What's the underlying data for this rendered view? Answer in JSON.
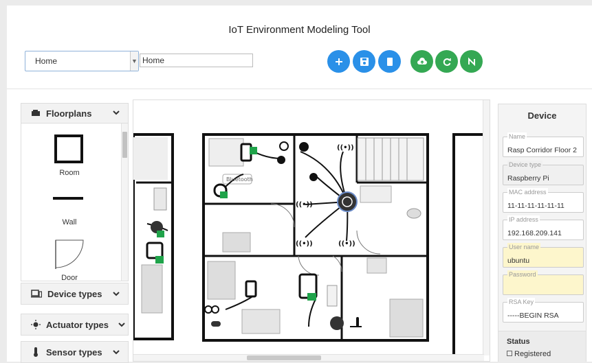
{
  "app": {
    "title": "IoT Environment Modeling Tool"
  },
  "toolbar": {
    "environment_select": "Home",
    "environment_name": "Home",
    "buttons": [
      {
        "icon": "plus-icon",
        "color": "#2a90e8"
      },
      {
        "icon": "save-icon",
        "color": "#2a90e8"
      },
      {
        "icon": "delete-icon",
        "color": "#2a90e8"
      },
      {
        "icon": "cloud-upload-icon",
        "color": "#34a853"
      },
      {
        "icon": "sync-icon",
        "color": "#34a853"
      },
      {
        "icon": "nodered-icon",
        "color": "#34a853"
      }
    ]
  },
  "left_panel": {
    "floorplans": {
      "label": "Floorplans",
      "items": [
        "Room",
        "Wall",
        "Door"
      ]
    },
    "device_types": {
      "label": "Device types"
    },
    "actuator_types": {
      "label": "Actuator types"
    },
    "sensor_types": {
      "label": "Sensor types"
    }
  },
  "canvas": {
    "room_labels": [
      "Bluetooth"
    ]
  },
  "device_panel": {
    "title": "Device",
    "fields": {
      "name": {
        "label": "Name",
        "value": "Rasp Corridor Floor 2"
      },
      "device_type": {
        "label": "Device type",
        "value": "Raspberry Pi"
      },
      "mac": {
        "label": "MAC address",
        "value": "11-11-11-11-11-11"
      },
      "ip": {
        "label": "IP address",
        "value": "192.168.209.141"
      },
      "username": {
        "label": "User name",
        "value": "ubuntu"
      },
      "password": {
        "label": "Password",
        "value": ""
      },
      "rsa": {
        "label": "RSA Key",
        "value": "-----BEGIN RSA"
      }
    },
    "status": {
      "label": "Status",
      "value": "Registered"
    }
  },
  "colors": {
    "accent_blue": "#2a90e8",
    "accent_green": "#34a853",
    "device_green": "#1fa34a"
  }
}
